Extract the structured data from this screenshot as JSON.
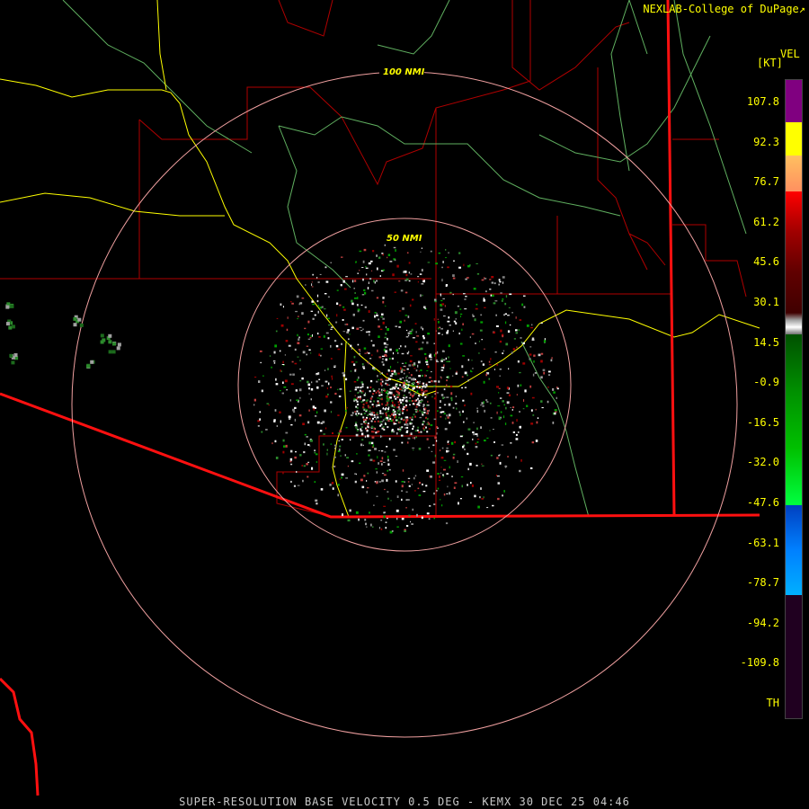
{
  "header": {
    "credit": "NEXLAB-College of DuPage"
  },
  "legend": {
    "product": "VEL",
    "unit": "[KT]",
    "ticks": [
      "107.8",
      "92.3",
      "76.7",
      "61.2",
      "45.6",
      "30.1",
      "14.5",
      "-0.9",
      "-16.5",
      "-32.0",
      "-47.6",
      "-63.1",
      "-78.7",
      "-94.2",
      "-109.8",
      "TH"
    ],
    "colors": [
      "#7a007a",
      "#ffff00",
      "#ffa060",
      "#ff0000",
      "#a00000",
      "#600000",
      "#ffffff",
      "#606060",
      "#007000",
      "#00c000",
      "#00ff40",
      "#0060ff",
      "#00a0ff",
      "#200020"
    ]
  },
  "rings": {
    "inner": "50 NMI",
    "outer": "100 NMI"
  },
  "footer": {
    "caption": "SUPER-RESOLUTION BASE VELOCITY 0.5 DEG - KEMX 30 DEC 25 04:46"
  }
}
